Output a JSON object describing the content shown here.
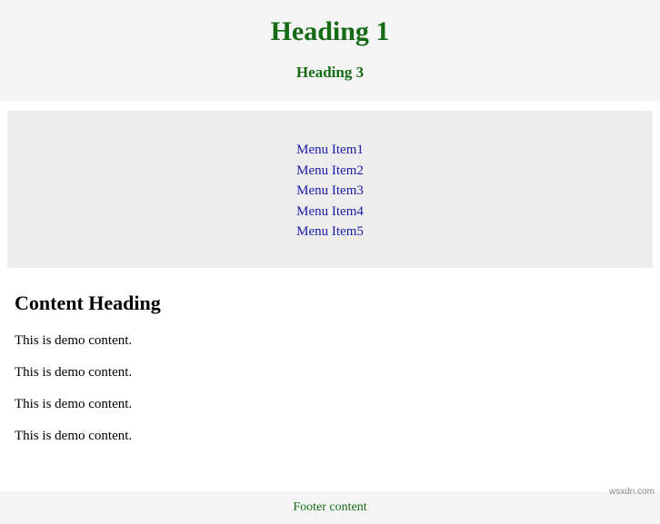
{
  "header": {
    "title": "Heading 1",
    "subtitle": "Heading 3"
  },
  "nav": {
    "items": [
      {
        "label": "Menu Item1"
      },
      {
        "label": "Menu Item2"
      },
      {
        "label": "Menu Item3"
      },
      {
        "label": "Menu Item4"
      },
      {
        "label": "Menu Item5"
      }
    ]
  },
  "content": {
    "heading": "Content Heading",
    "paragraphs": [
      "This is demo content.",
      "This is demo content.",
      "This is demo content.",
      "This is demo content."
    ]
  },
  "footer": {
    "text": "Footer content"
  },
  "watermark": "wsxdn.com"
}
